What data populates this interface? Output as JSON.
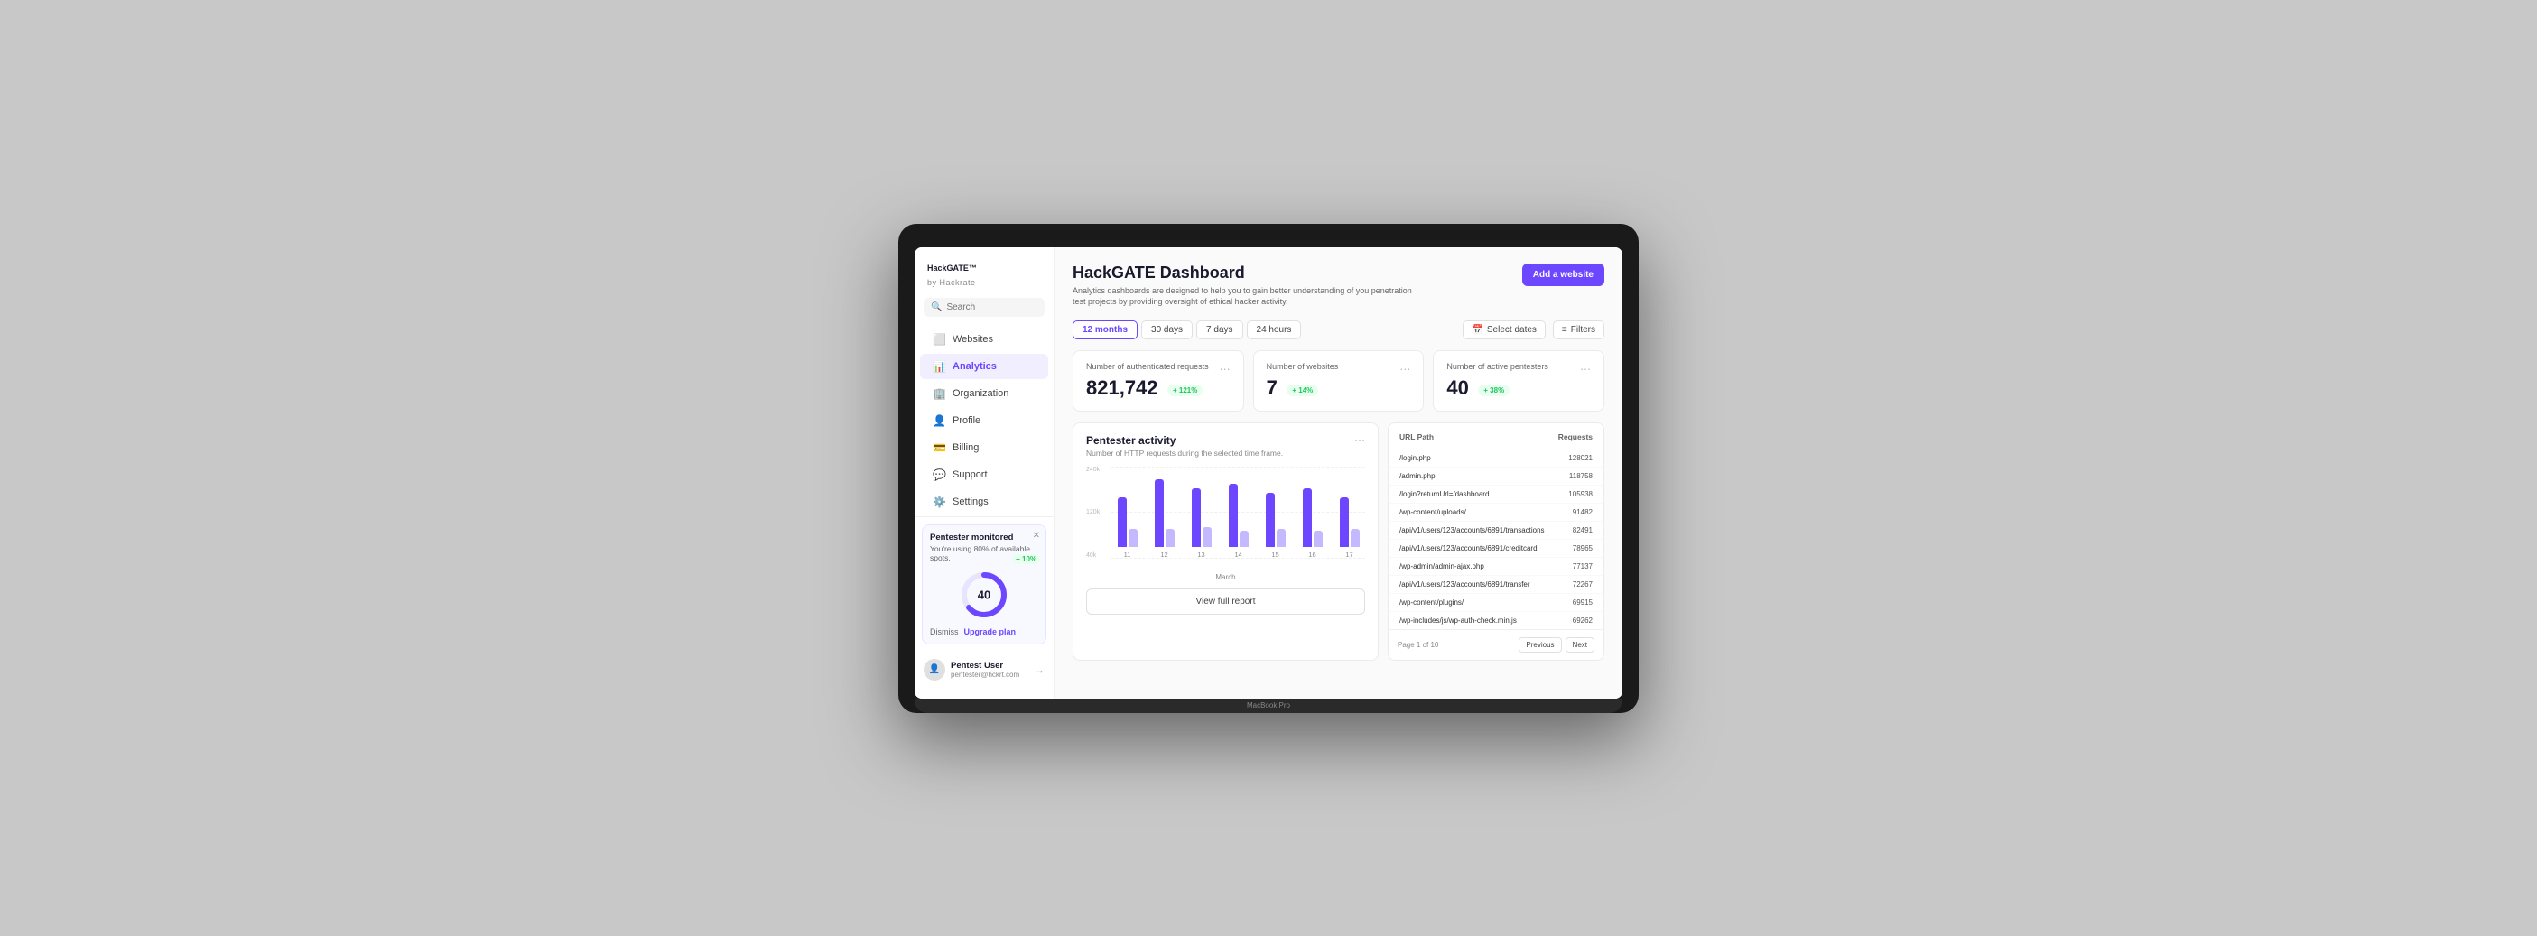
{
  "app": {
    "name": "HackGATE",
    "trademark": "™",
    "sub": "by Hackrate"
  },
  "sidebar": {
    "search_placeholder": "Search",
    "nav_items": [
      {
        "id": "websites",
        "label": "Websites",
        "icon": "🌐",
        "active": false
      },
      {
        "id": "analytics",
        "label": "Analytics",
        "icon": "📊",
        "active": true
      },
      {
        "id": "organization",
        "label": "Organization",
        "icon": "🏢",
        "active": false
      },
      {
        "id": "profile",
        "label": "Profile",
        "icon": "👤",
        "active": false
      },
      {
        "id": "billing",
        "label": "Billing",
        "icon": "💳",
        "active": false
      },
      {
        "id": "support",
        "label": "Support",
        "icon": "💬",
        "active": false
      },
      {
        "id": "settings",
        "label": "Settings",
        "icon": "⚙️",
        "active": false
      }
    ],
    "pentester_card": {
      "title": "Pentester monitored",
      "subtitle": "You're using 80% of available spots.",
      "badge": "+ 10%",
      "value": "40",
      "dismiss": "Dismiss",
      "upgrade": "Upgrade plan"
    },
    "user": {
      "name": "Pentest User",
      "email": "pentester@hckrt.com"
    }
  },
  "header": {
    "title": "HackGATE Dashboard",
    "subtitle": "Analytics dashboards are designed to help you to gain better understanding of you penetration test projects by providing oversight of ethical hacker activity.",
    "add_btn": "Add a website"
  },
  "time_filters": [
    {
      "label": "12 months",
      "active": true
    },
    {
      "label": "30 days",
      "active": false
    },
    {
      "label": "7 days",
      "active": false
    },
    {
      "label": "24 hours",
      "active": false
    }
  ],
  "filter_btns": [
    {
      "label": "Select dates",
      "icon": "📅"
    },
    {
      "label": "Filters",
      "icon": "≡"
    }
  ],
  "stats": [
    {
      "label": "Number of authenticated requests",
      "value": "821,742",
      "badge": "+ 121%"
    },
    {
      "label": "Number of websites",
      "value": "7",
      "badge": "+ 14%"
    },
    {
      "label": "Number of active pentesters",
      "value": "40",
      "badge": "+ 38%"
    }
  ],
  "chart": {
    "title": "Pentester activity",
    "subtitle": "Number of HTTP requests during the selected time frame.",
    "x_label": "March",
    "y_labels": [
      "240k",
      "120k",
      "40k"
    ],
    "bars": [
      {
        "label": "11",
        "dark": 55,
        "light": 20
      },
      {
        "label": "12",
        "dark": 75,
        "light": 20
      },
      {
        "label": "13",
        "dark": 65,
        "light": 22
      },
      {
        "label": "14",
        "dark": 70,
        "light": 18
      },
      {
        "label": "15",
        "dark": 60,
        "light": 20
      },
      {
        "label": "16",
        "dark": 65,
        "light": 18
      },
      {
        "label": "17",
        "dark": 55,
        "light": 20
      }
    ],
    "view_full": "View full report"
  },
  "url_table": {
    "col_path": "URL Path",
    "col_requests": "Requests",
    "rows": [
      {
        "path": "/login.php",
        "requests": "128021"
      },
      {
        "path": "/admin.php",
        "requests": "118758"
      },
      {
        "path": "/login?returnUrl=/dashboard",
        "requests": "105938"
      },
      {
        "path": "/wp-content/uploads/",
        "requests": "91482"
      },
      {
        "path": "/api/v1/users/123/accounts/6891/transactions",
        "requests": "82491"
      },
      {
        "path": "/api/v1/users/123/accounts/6891/creditcard",
        "requests": "78965"
      },
      {
        "path": "/wp-admin/admin-ajax.php",
        "requests": "77137"
      },
      {
        "path": "/api/v1/users/123/accounts/6891/transfer",
        "requests": "72267"
      },
      {
        "path": "/wp-content/plugins/",
        "requests": "69915"
      },
      {
        "path": "/wp-includes/js/wp-auth-check.min.js",
        "requests": "69262"
      }
    ],
    "page_info": "Page 1 of 10",
    "prev": "Previous",
    "next": "Next"
  },
  "colors": {
    "purple": "#6c47ff",
    "purple_light": "#a08aff",
    "purple_bg": "#f0eeff",
    "green": "#22c55e",
    "green_bg": "#e8fff0"
  }
}
